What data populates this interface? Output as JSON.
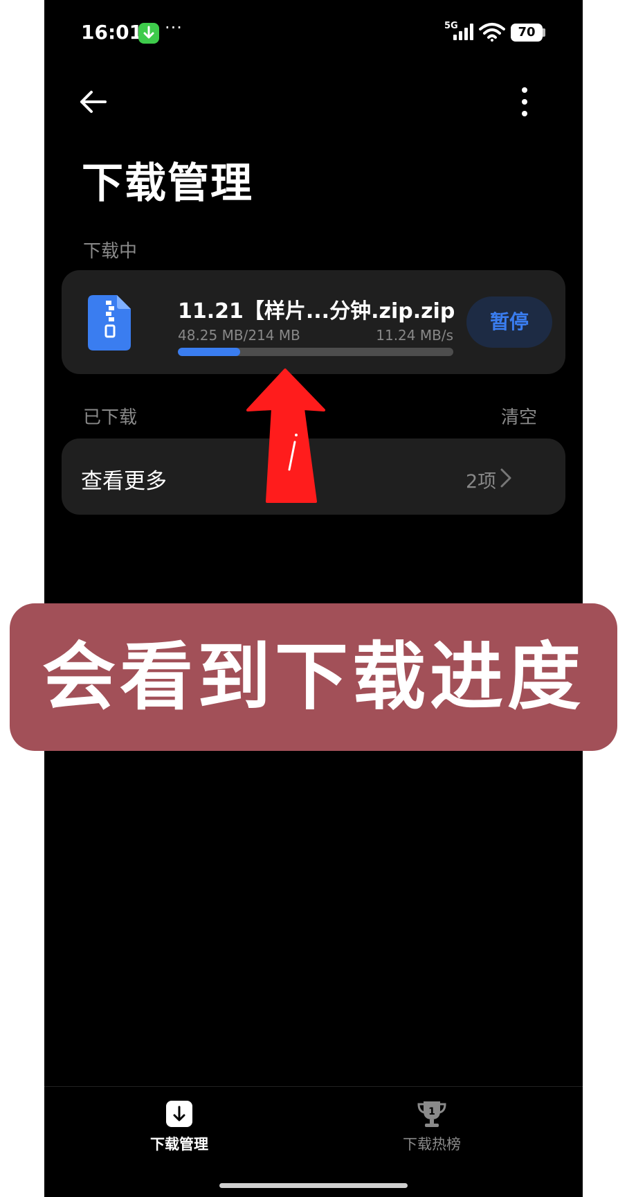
{
  "status_bar": {
    "time": "16:01",
    "notification_more": "···",
    "signal_label": "5G",
    "battery_level": "70"
  },
  "header": {
    "title": "下载管理"
  },
  "downloading": {
    "section_label": "下载中",
    "file_name": "11.21【样片...分钟.zip.zip",
    "size_progress": "48.25 MB/214 MB",
    "speed": "11.24 MB/s",
    "progress_fraction": 0.225,
    "pause_label": "暂停"
  },
  "downloaded": {
    "section_label": "已下载",
    "clear_label": "清空",
    "view_more_label": "查看更多",
    "item_count": "2项"
  },
  "caption": {
    "text": "会看到下载进度"
  },
  "bottom_nav": {
    "items": [
      {
        "label": "下载管理",
        "icon": "download-icon",
        "active": true
      },
      {
        "label": "下载热榜",
        "icon": "trophy-icon",
        "active": false
      }
    ]
  },
  "colors": {
    "accent_blue": "#3a7df0",
    "card_bg": "#1f1f1f",
    "caption_bg": "#a25058",
    "arrow_red": "#ff1c1c"
  }
}
